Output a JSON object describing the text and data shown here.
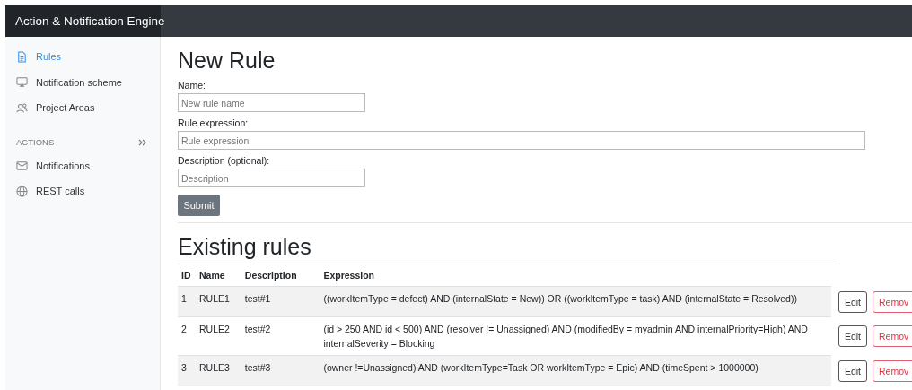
{
  "brand": "Action & Notification Engine",
  "sidebar": {
    "items": [
      {
        "label": "Rules",
        "kind": "document",
        "selected": true
      },
      {
        "label": "Notification scheme",
        "kind": "screen",
        "selected": false
      },
      {
        "label": "Project Areas",
        "kind": "people",
        "selected": false
      }
    ],
    "section": {
      "heading": "ACTIONS",
      "items": [
        {
          "label": "Notifications",
          "kind": "mail",
          "selected": false
        },
        {
          "label": "REST calls",
          "kind": "globe",
          "selected": false
        }
      ]
    }
  },
  "form": {
    "title": "New Rule",
    "fields": [
      {
        "label": "Name:",
        "placeholder": "New rule name"
      },
      {
        "label": "Rule expression:",
        "placeholder": "Rule expression"
      },
      {
        "label": "Description (optional):",
        "placeholder": "Description"
      }
    ],
    "submit": "Submit"
  },
  "rules": {
    "title": "Existing rules",
    "columns": [
      "ID",
      "Name",
      "Description",
      "Expression"
    ],
    "rows": [
      {
        "id": "1",
        "name": "RULE1",
        "description": "test#1",
        "expression": "((workItemType = defect) AND (internalState = New)) OR ((workItemType = task) AND (internalState = Resolved))",
        "edit": "Edit",
        "remove": "Remov"
      },
      {
        "id": "2",
        "name": "RULE2",
        "description": "test#2",
        "expression": "(id > 250 AND id < 500) AND (resolver != Unassigned) AND (modifiedBy = myadmin AND internalPriority=High) AND internalSeverity = Blocking",
        "edit": "Edit",
        "remove": "Remov"
      },
      {
        "id": "3",
        "name": "RULE3",
        "description": "test#3",
        "expression": "(owner !=Unassigned) AND (workItemType=Task OR workItemType = Epic) AND (timeSpent > 1000000)",
        "edit": "Edit",
        "remove": "Remov"
      }
    ]
  }
}
